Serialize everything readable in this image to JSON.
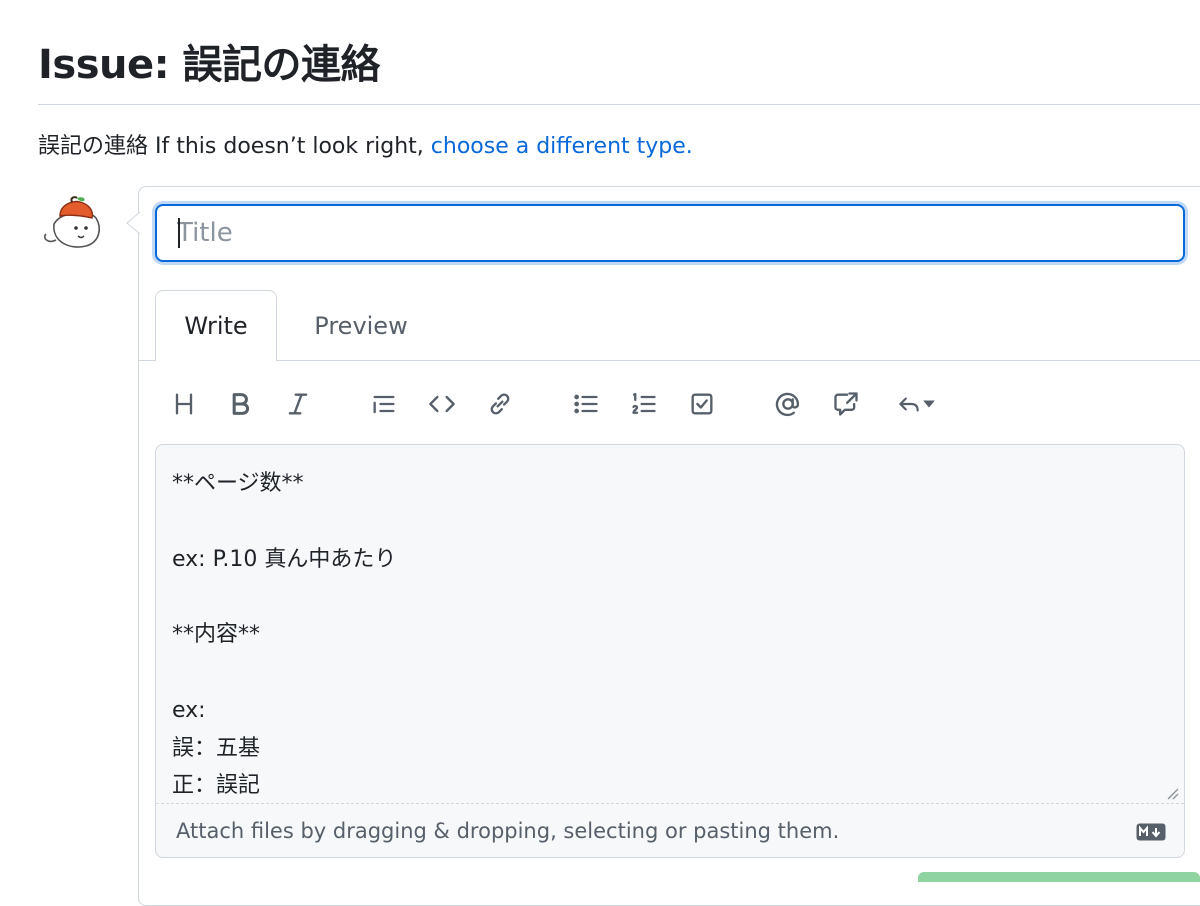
{
  "page": {
    "title": "Issue: 誤記の連絡"
  },
  "template_note": {
    "type_name": "誤記の連絡",
    "prompt": " If this doesn’t look right, ",
    "link": "choose a different type."
  },
  "issue_form": {
    "title_placeholder": "Title",
    "tabs": [
      {
        "label": "Write",
        "active": true
      },
      {
        "label": "Preview",
        "active": false
      }
    ],
    "toolbar": [
      {
        "name": "heading",
        "icon": "heading-icon"
      },
      {
        "name": "bold",
        "icon": "bold-icon"
      },
      {
        "name": "italic",
        "icon": "italic-icon"
      },
      {
        "name": "quote",
        "icon": "quote-icon"
      },
      {
        "name": "code",
        "icon": "code-icon"
      },
      {
        "name": "link",
        "icon": "link-icon"
      },
      {
        "name": "unordered-list",
        "icon": "list-unordered-icon"
      },
      {
        "name": "ordered-list",
        "icon": "list-ordered-icon"
      },
      {
        "name": "task-list",
        "icon": "tasklist-icon"
      },
      {
        "name": "mention",
        "icon": "mention-icon"
      },
      {
        "name": "reference",
        "icon": "cross-reference-icon"
      },
      {
        "name": "saved-replies",
        "icon": "reply-icon"
      }
    ],
    "body_text": "**ページ数**\n\nex: P.10 真ん中あたり\n\n**内容**\n\nex:\n誤：五基\n正：誤記",
    "attach_hint": "Attach files by dragging & dropping, selecting or pasting them."
  },
  "colors": {
    "accent": "#0969da",
    "border": "#d0d7de",
    "muted_text": "#57606a",
    "submit_green": "#8fd3a0"
  }
}
